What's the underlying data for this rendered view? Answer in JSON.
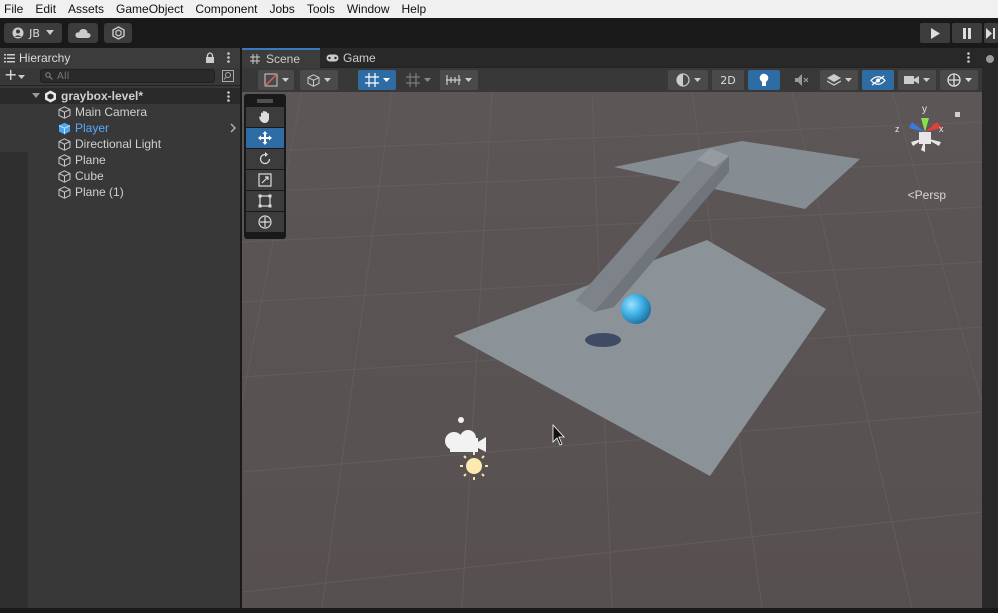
{
  "menu": {
    "items": [
      "File",
      "Edit",
      "Assets",
      "GameObject",
      "Component",
      "Jobs",
      "Tools",
      "Window",
      "Help"
    ]
  },
  "toolbar": {
    "account_label": "JB",
    "icons": [
      "account-icon",
      "cloud-icon",
      "collab-icon"
    ],
    "play_icons": [
      "play-icon",
      "pause-icon",
      "step-icon"
    ]
  },
  "hierarchy": {
    "tab_label": "Hierarchy",
    "add_label": "+",
    "search_placeholder": "All",
    "scene_name": "graybox-level*",
    "items": [
      {
        "label": "Main Camera",
        "selected": false
      },
      {
        "label": "Player",
        "selected": true
      },
      {
        "label": "Directional Light",
        "selected": false
      },
      {
        "label": "Plane",
        "selected": false
      },
      {
        "label": "Cube",
        "selected": false
      },
      {
        "label": "Plane (1)",
        "selected": false
      }
    ]
  },
  "scene": {
    "tabs": [
      {
        "label": "Scene",
        "active": true
      },
      {
        "label": "Game",
        "active": false
      }
    ],
    "toolbar": {
      "mode_2d_label": "2D"
    },
    "persp_label": "Persp",
    "gizmo_axes": {
      "x": "x",
      "y": "y",
      "z": "z"
    },
    "tools": [
      "hand-tool-icon",
      "move-tool-icon",
      "rotate-tool-icon",
      "scale-tool-icon",
      "rect-tool-icon",
      "transform-tool-icon"
    ],
    "active_tool": "move-tool-icon"
  },
  "colors": {
    "accent": "#3a79bb",
    "selected_text": "#58a9ff",
    "viewport_bg": "#5a5353",
    "plane": "#8e959b",
    "sphere": "#3fb1e6"
  }
}
